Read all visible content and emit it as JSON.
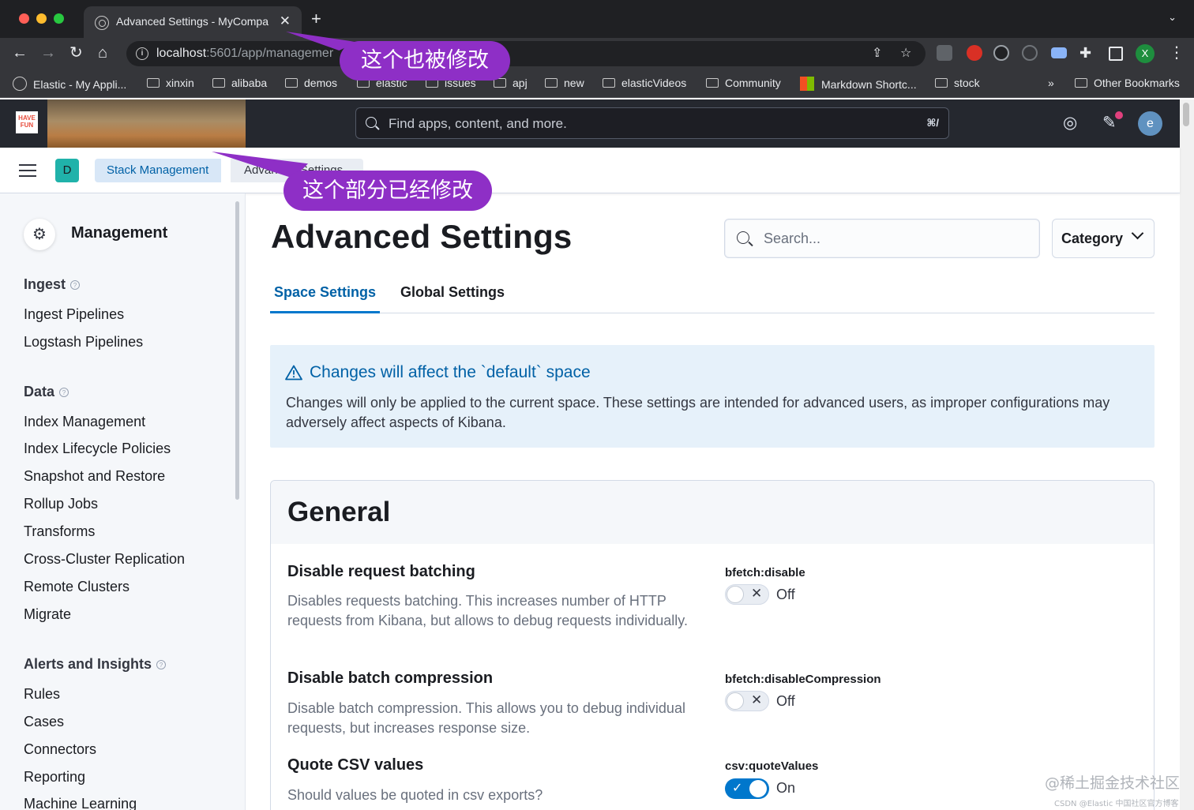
{
  "browser": {
    "tab_title": "Advanced Settings - MyCompa",
    "url_host": "localhost",
    "url_rest": ":5601/app/managemer",
    "profile_initial": "X",
    "bookmarks": [
      "Elastic - My Appli...",
      "xinxin",
      "alibaba",
      "demos",
      "elastic",
      "issues",
      "apj",
      "new",
      "elasticVideos",
      "Community",
      "Markdown Shortc...",
      "stock",
      "Other Bookmarks"
    ],
    "bookmarks_overflow": "»"
  },
  "callouts": {
    "top": "这个也被修改",
    "breadcrumb": "这个部分已经修改"
  },
  "header": {
    "logo_text": "HAVE FUN",
    "search_placeholder": "Find apps, content, and more.",
    "search_shortcut": "⌘/",
    "user_initial": "e"
  },
  "breadcrumbs": {
    "space_initial": "D",
    "items": [
      "Stack Management",
      "Advanced Settings"
    ]
  },
  "sidebar": {
    "title": "Management",
    "groups": [
      {
        "label": "Ingest",
        "items": [
          "Ingest Pipelines",
          "Logstash Pipelines"
        ]
      },
      {
        "label": "Data",
        "items": [
          "Index Management",
          "Index Lifecycle Policies",
          "Snapshot and Restore",
          "Rollup Jobs",
          "Transforms",
          "Cross-Cluster Replication",
          "Remote Clusters",
          "Migrate"
        ]
      },
      {
        "label": "Alerts and Insights",
        "items": [
          "Rules",
          "Cases",
          "Connectors",
          "Reporting",
          "Machine Learning"
        ]
      }
    ]
  },
  "main": {
    "title": "Advanced Settings",
    "search_placeholder": "Search...",
    "category_label": "Category",
    "tabs": [
      "Space Settings",
      "Global Settings"
    ],
    "warning": {
      "title": "Changes will affect the `default` space",
      "body": "Changes will only be applied to the current space. These settings are intended for advanced users, as improper configurations may adversely affect aspects of Kibana."
    },
    "section": {
      "title": "General",
      "settings": [
        {
          "title": "Disable request batching",
          "description": "Disables requests batching. This increases number of HTTP requests from Kibana, but allows to debug requests individually.",
          "key": "bfetch:disable",
          "state": "Off"
        },
        {
          "title": "Disable batch compression",
          "description": "Disable batch compression. This allows you to debug individual requests, but increases response size.",
          "key": "bfetch:disableCompression",
          "state": "Off"
        },
        {
          "title": "Quote CSV values",
          "description": "Should values be quoted in csv exports?",
          "key": "csv:quoteValues",
          "state": "On"
        }
      ]
    }
  },
  "watermark": {
    "main": "@稀土掘金技术社区",
    "small": "CSDN @Elastic 中国社区官方博客"
  },
  "colors": {
    "accent": "#0077cc",
    "link": "#0061a6",
    "callout": "#8e2fc6",
    "header_bg": "#25282f"
  }
}
